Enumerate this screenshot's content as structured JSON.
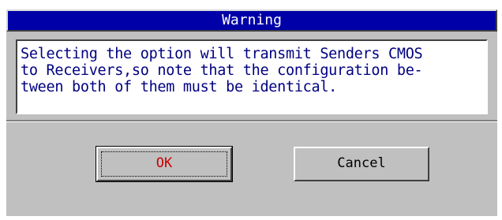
{
  "dialog": {
    "title": "Warning",
    "message_lines": [
      "Selecting the option will transmit Senders CMOS",
      "to Receivers,so note that the configuration be-",
      "tween both of them must be identical."
    ],
    "buttons": {
      "ok_label": "OK",
      "cancel_label": "Cancel"
    }
  },
  "colors": {
    "titlebar": "#0000a8",
    "message_text": "#000080",
    "ok_text": "#c80000",
    "panel": "#c0c0c0"
  }
}
